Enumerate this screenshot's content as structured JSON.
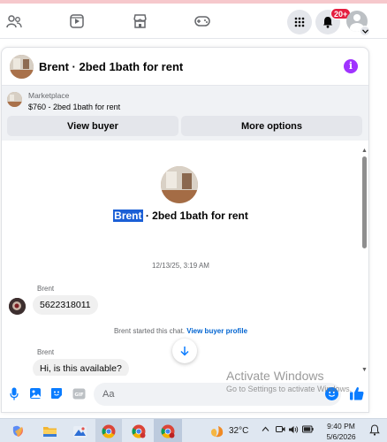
{
  "header": {
    "title": "Brent · 2bed 1bath for rent",
    "info_icon": "info-icon",
    "info_color": "#a033ff"
  },
  "nav": {
    "notification_badge": "20+",
    "icons": [
      "friends-icon",
      "watch-icon",
      "marketplace-icon",
      "gaming-icon",
      "menu-grid-icon",
      "bell-icon",
      "account-avatar"
    ]
  },
  "marketplace": {
    "label": "Marketplace",
    "listing": "$760 - 2bed 1bath for rent",
    "view_buyer": "View buyer",
    "more_options": "More options"
  },
  "conversation": {
    "name_highlighted": "Brent",
    "title_rest": " · 2bed 1bath for rent",
    "timestamp": "12/13/25, 3:19 AM",
    "messages": [
      {
        "sender": "Brent",
        "text": "5622318011"
      },
      {
        "sender": "Brent",
        "text": "Hi, is this available?"
      }
    ],
    "system_note_text": "Brent started this chat.",
    "system_note_link": "View buyer profile"
  },
  "composer": {
    "placeholder": "Aa",
    "icons": [
      "microphone-icon",
      "photo-icon",
      "sticker-icon",
      "gif-icon",
      "emoji-icon",
      "like-icon"
    ],
    "accent_color": "#0a7cff"
  },
  "watermark": {
    "title": "Activate Windows",
    "subtitle": "Go to Settings to activate Windows."
  },
  "taskbar": {
    "temperature": "32°C",
    "time": "9:40 PM",
    "date": "5/6/2026"
  }
}
